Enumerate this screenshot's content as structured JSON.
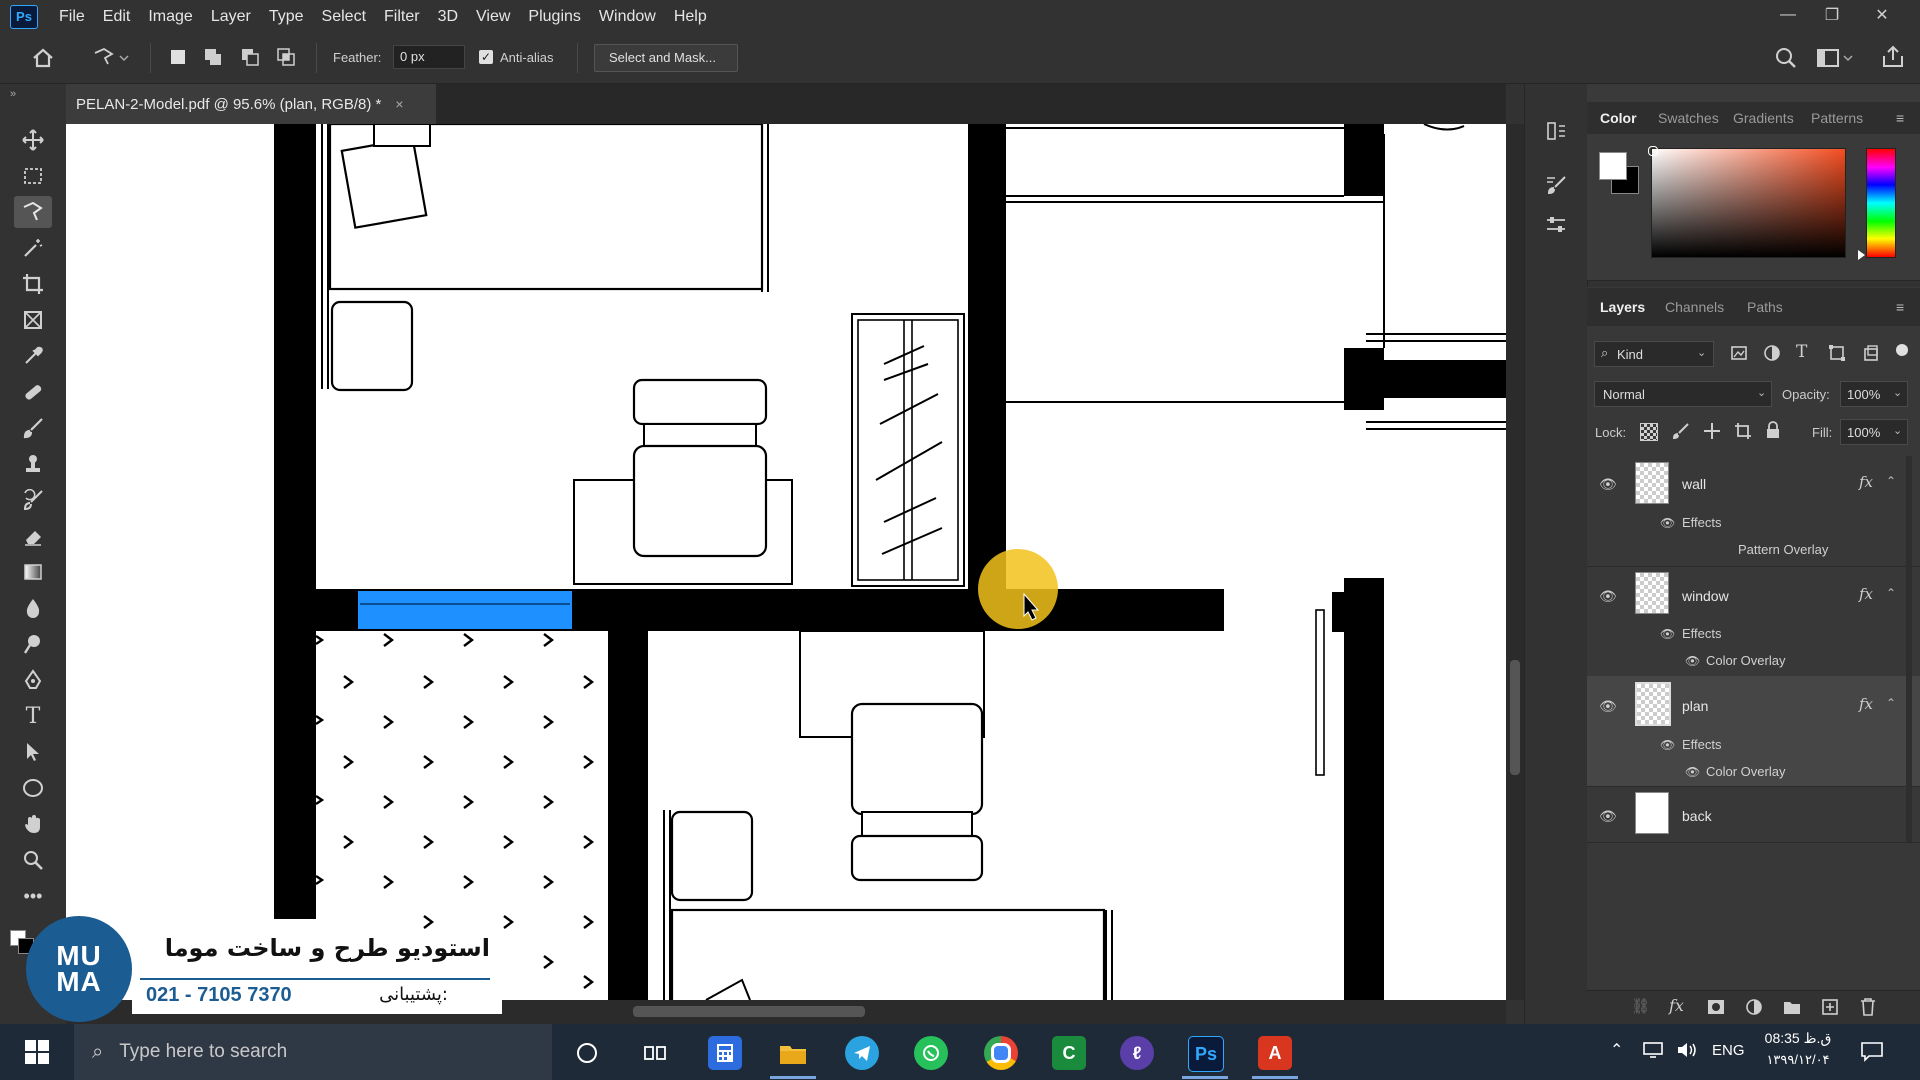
{
  "app": {
    "logo_text": "Ps"
  },
  "menu": [
    "File",
    "Edit",
    "Image",
    "Layer",
    "Type",
    "Select",
    "Filter",
    "3D",
    "View",
    "Plugins",
    "Window",
    "Help"
  ],
  "window_controls": [
    "—",
    "❐",
    "✕"
  ],
  "options": {
    "feather_label": "Feather:",
    "feather_value": "0 px",
    "antialias_label": "Anti-alias",
    "antialias_checked": true,
    "select_mask_label": "Select and Mask..."
  },
  "document": {
    "tab_title": "PELAN-2-Model.pdf @ 95.6% (plan, RGB/8) *",
    "close": "×"
  },
  "color_panel": {
    "tabs": [
      "Color",
      "Swatches",
      "Gradients",
      "Patterns"
    ],
    "active": "Color",
    "fg": "#ffffff",
    "bg": "#000000"
  },
  "layers_panel": {
    "tabs": [
      "Layers",
      "Channels",
      "Paths"
    ],
    "active": "Layers",
    "filter_kind": "Kind",
    "blend_mode": "Normal",
    "opacity_label": "Opacity:",
    "opacity_value": "100%",
    "lock_label": "Lock:",
    "fill_label": "Fill:",
    "fill_value": "100%",
    "layers": [
      {
        "name": "wall",
        "fx": "fx",
        "effects_label": "Effects",
        "effect": "Pattern Overlay",
        "selected": false
      },
      {
        "name": "window",
        "fx": "fx",
        "effects_label": "Effects",
        "effect": "Color Overlay",
        "selected": false
      },
      {
        "name": "plan",
        "fx": "fx",
        "effects_label": "Effects",
        "effect": "Color Overlay",
        "selected": true
      },
      {
        "name": "back",
        "selected": false
      }
    ]
  },
  "watermark": {
    "logo": "MU MA",
    "title": "استودیو طرح و ساخت موما",
    "phone": "021 - 7105 7370",
    "support": ":پشتیبانی"
  },
  "taskbar": {
    "search_placeholder": "Type here to search",
    "lang": "ENG",
    "time": "08:35 ق.ظ",
    "date": "۱۳۹۹/۱۲/۰۴"
  },
  "colors": {
    "accent": "#31a8ff",
    "window_highlight": "#1e90ff",
    "cursor_highlight": "#f2c21b"
  }
}
